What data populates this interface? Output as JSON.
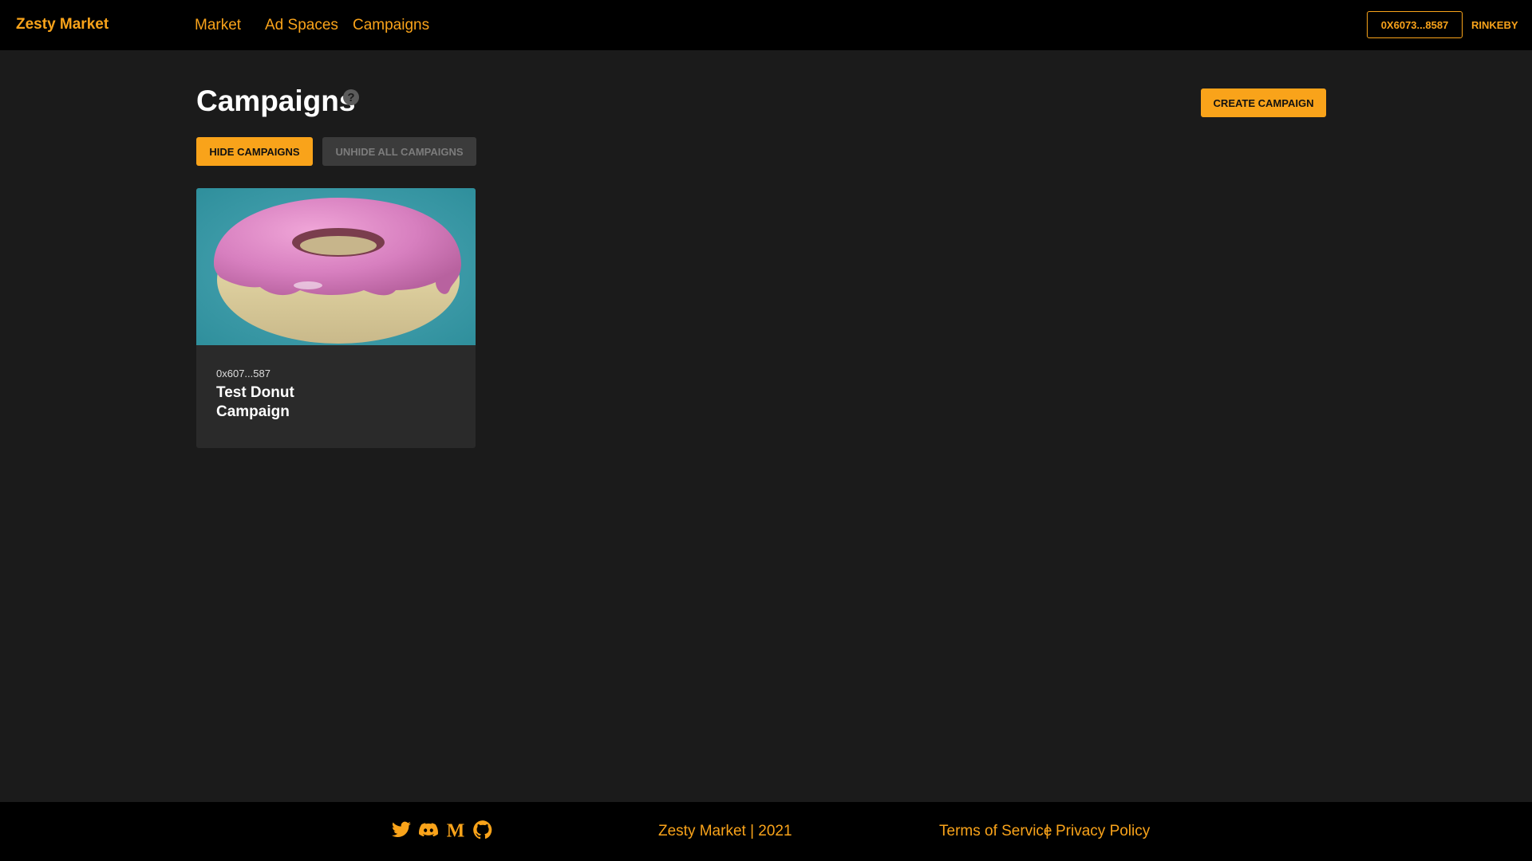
{
  "header": {
    "brand": "Zesty Market",
    "nav": [
      {
        "label": "Market"
      },
      {
        "label": "Ad Spaces"
      },
      {
        "label": "Campaigns"
      }
    ],
    "wallet": "0X6073...8587",
    "network": "RINKEBY"
  },
  "main": {
    "title": "Campaigns",
    "help_icon": "?",
    "create_button": "CREATE CAMPAIGN",
    "hide_button": "HIDE CAMPAIGNS",
    "unhide_button": "UNHIDE ALL CAMPAIGNS",
    "campaigns": [
      {
        "owner": "0x607...587",
        "title": "Test Donut Campaign",
        "image": "donut-illustration"
      }
    ]
  },
  "footer": {
    "social_icons": [
      "twitter-icon",
      "discord-icon",
      "medium-icon",
      "github-icon"
    ],
    "copyright": "Zesty Market | 2021",
    "terms": "Terms of Service",
    "separator": "|",
    "privacy": "Privacy Policy"
  },
  "colors": {
    "accent": "#f9a31a",
    "background": "#1b1b1b",
    "header": "#000000",
    "card": "#2a2a2a"
  }
}
